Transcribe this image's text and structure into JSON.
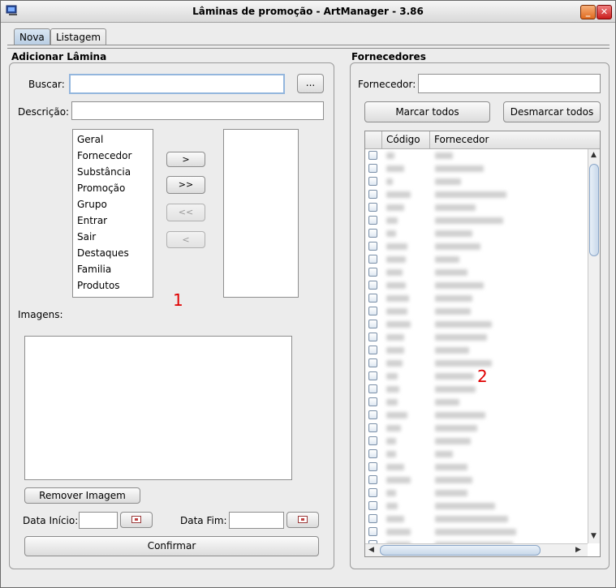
{
  "window": {
    "title": "Lâminas de promoção - ArtManager - 3.86",
    "minimize_glyph": "_",
    "close_glyph": "✕"
  },
  "tabs": [
    {
      "label": "Nova"
    },
    {
      "label": "Listagem"
    }
  ],
  "left": {
    "section_title": "Adicionar Lâmina",
    "search_label": "Buscar:",
    "search_value": "",
    "search_browse_label": "...",
    "description_label": "Descrição:",
    "description_value": "",
    "available_items": [
      "Geral",
      "Fornecedor",
      "Substância",
      "Promoção",
      "Grupo",
      "Entrar",
      "Sair",
      "Destaques",
      "Familia",
      "Produtos"
    ],
    "move_buttons": [
      {
        "label": ">"
      },
      {
        "label": ">>"
      },
      {
        "label": "<<"
      },
      {
        "label": "<"
      }
    ],
    "marker": "1",
    "images_label": "Imagens:",
    "remove_image_label": "Remover Imagem",
    "start_date_label": "Data Início:",
    "start_date_value": "",
    "end_date_label": "Data Fim:",
    "end_date_value": "",
    "confirm_label": "Confirmar"
  },
  "right": {
    "section_title": "Fornecedores",
    "supplier_label": "Fornecedor:",
    "supplier_value": "",
    "select_all_label": "Marcar todos",
    "deselect_all_label": "Desmarcar todos",
    "columns": [
      "Código",
      "Fornecedor"
    ],
    "marker": "2"
  },
  "colors": {
    "marker": "#e00000",
    "tab_active": "#b8cde3"
  }
}
